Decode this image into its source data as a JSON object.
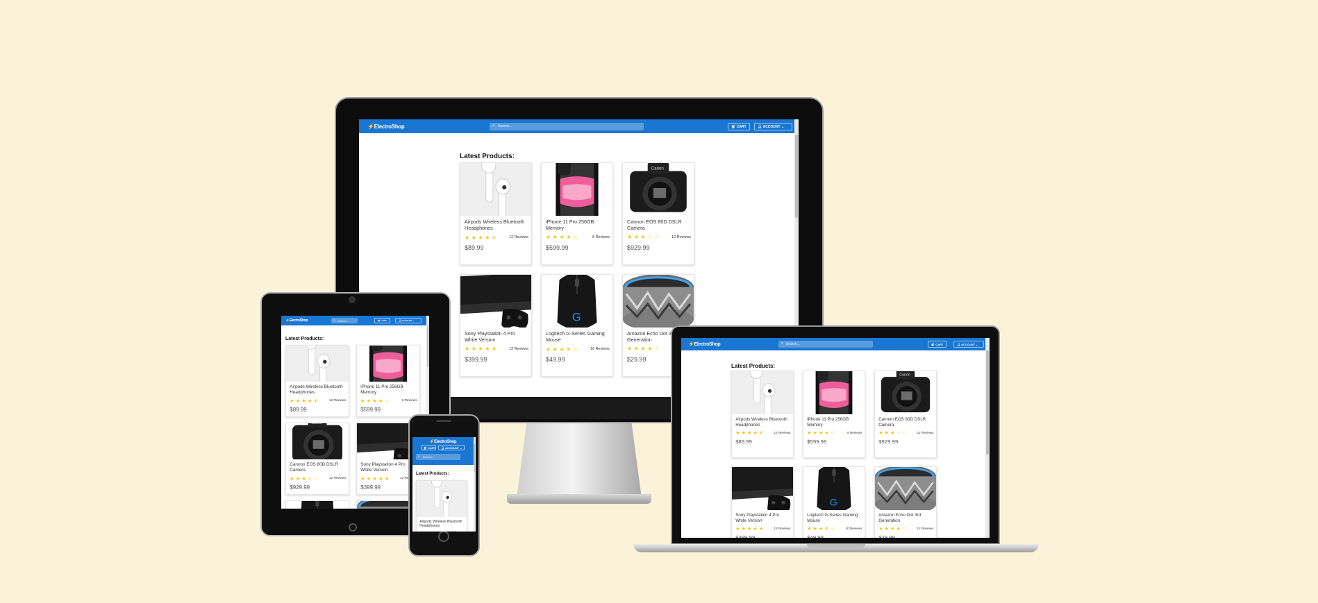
{
  "site": {
    "logo": "⚡ElectroShop",
    "search_placeholder": "Search...",
    "cart_label": "CART",
    "account_label": "ACCOUNT",
    "heading": "Latest Products:"
  },
  "colors": {
    "background": "#fbf3d9",
    "nav": "#1976d2",
    "star": "#f4c20d"
  },
  "products": [
    {
      "name": "Airpods Wireless Bluetooth Headphones",
      "rating": 4.5,
      "reviews": "12 Reviews",
      "price": "$89.99",
      "image": "airpods"
    },
    {
      "name": "iPhone 11 Pro 256GB Memory",
      "rating": 4,
      "reviews": "8 Reviews",
      "price": "$599.99",
      "image": "iphone"
    },
    {
      "name": "Cannon EOS 80D DSLR Camera",
      "rating": 3,
      "reviews": "12 Reviews",
      "price": "$929.99",
      "image": "camera"
    },
    {
      "name": "Sony Playstation 4 Pro White Version",
      "rating": 5,
      "reviews": "12 Reviews",
      "price": "$399.99",
      "image": "ps4"
    },
    {
      "name": "Logitech G-Series Gaming Mouse",
      "rating": 3.5,
      "reviews": "10 Reviews",
      "price": "$49.99",
      "image": "mouse"
    },
    {
      "name": "Amazon Echo Dot 3rd Generation",
      "rating": 4,
      "reviews": "12 Reviews",
      "price": "$29.99",
      "image": "echo"
    }
  ]
}
